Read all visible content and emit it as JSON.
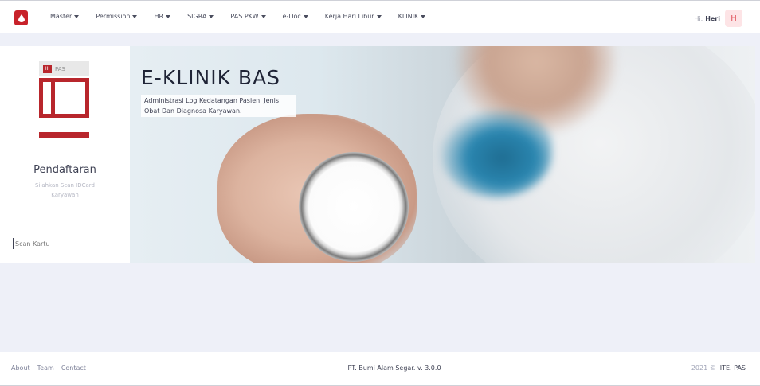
{
  "navbar": {
    "brand_icon": "blood-drop-icon",
    "brand_color": "#c8222a",
    "items": [
      {
        "label": "Master"
      },
      {
        "label": "Permission"
      },
      {
        "label": "HR"
      },
      {
        "label": "SIGRA"
      },
      {
        "label": "PAS PKW"
      },
      {
        "label": "e-Doc"
      },
      {
        "label": "Kerja Hari Libur"
      },
      {
        "label": "KLINIK"
      }
    ],
    "greeting": "Hi,",
    "user_name": "Heri",
    "avatar_initial": "H"
  },
  "registration": {
    "logo_text": "PAS",
    "logo_mark": "III",
    "title": "Pendaftaran",
    "subtitle": "Silahkan Scan IDCard Karyawan",
    "scan_placeholder": "Scan Kartu"
  },
  "hero": {
    "title": "E-KLINIK BAS",
    "description": "Administrasi Log Kedatangan Pasien, Jenis Obat Dan Diagnosa Karyawan."
  },
  "footer": {
    "links": [
      {
        "label": "About"
      },
      {
        "label": "Team"
      },
      {
        "label": "Contact"
      }
    ],
    "company": "PT. Bumi Alam Segar. v. 3.0.0",
    "year": "2021 ©",
    "org": "ITE. PAS"
  }
}
